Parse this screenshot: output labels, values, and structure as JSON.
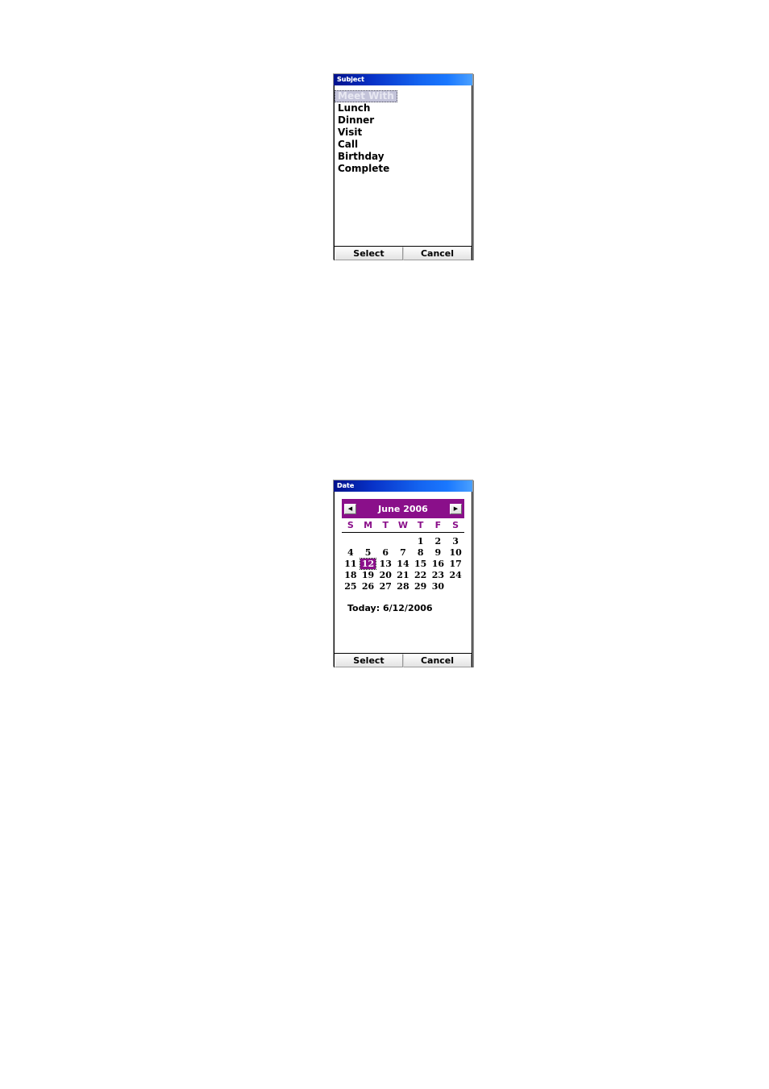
{
  "subject_dialog": {
    "title": "Subject",
    "items": [
      {
        "label": "Meet With",
        "selected": true
      },
      {
        "label": "Lunch",
        "selected": false
      },
      {
        "label": "Dinner",
        "selected": false
      },
      {
        "label": "Visit",
        "selected": false
      },
      {
        "label": "Call",
        "selected": false
      },
      {
        "label": "Birthday",
        "selected": false
      },
      {
        "label": "Complete",
        "selected": false
      }
    ],
    "select_label": "Select",
    "cancel_label": "Cancel"
  },
  "date_dialog": {
    "title": "Date",
    "calendar": {
      "month_year": "June 2006",
      "prev_icon": "left-arrow-icon",
      "next_icon": "right-arrow-icon",
      "weekdays": [
        "S",
        "M",
        "T",
        "W",
        "T",
        "F",
        "S"
      ],
      "weeks": [
        [
          "",
          "",
          "",
          "",
          "1",
          "2",
          "3"
        ],
        [
          "4",
          "5",
          "6",
          "7",
          "8",
          "9",
          "10"
        ],
        [
          "11",
          "12",
          "13",
          "14",
          "15",
          "16",
          "17"
        ],
        [
          "18",
          "19",
          "20",
          "21",
          "22",
          "23",
          "24"
        ],
        [
          "25",
          "26",
          "27",
          "28",
          "29",
          "30",
          ""
        ]
      ],
      "selected_day": "12",
      "today_label": "Today: 6/12/2006"
    },
    "select_label": "Select",
    "cancel_label": "Cancel"
  },
  "colors": {
    "titlebar_blue_dark": "#00118c",
    "titlebar_blue_light": "#4aa0ff",
    "calendar_purple": "#8a0f8a",
    "selection_lavender": "#c3c3d9"
  }
}
